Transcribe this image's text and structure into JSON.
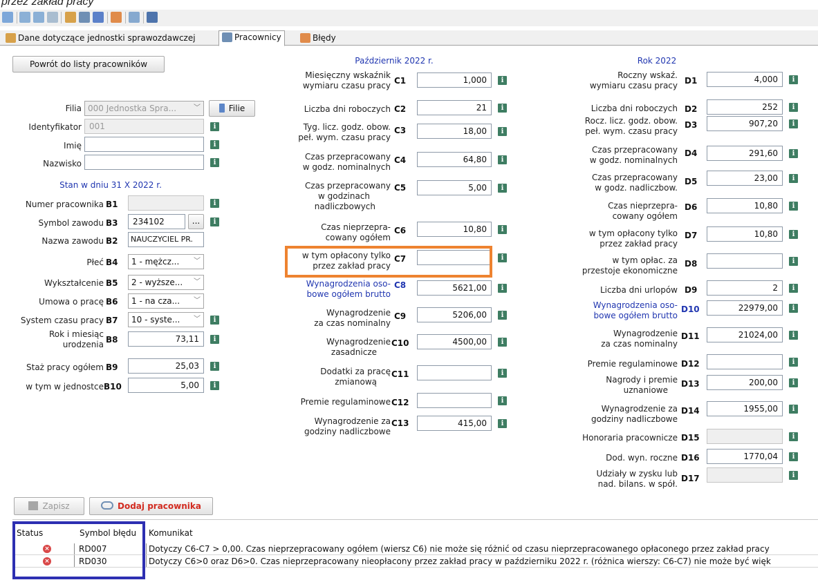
{
  "caption": "przez zakład pracy",
  "toolbar": {
    "icons": [
      "print-icon",
      "import-icon",
      "export-icon",
      "upload-icon",
      "home-icon",
      "glasses-icon",
      "copy-icon",
      "people-icon",
      "window-icon",
      "hierarchy-icon"
    ]
  },
  "tabs": [
    {
      "label": "Dane dotyczące jednostki sprawozdawczej",
      "icon": "home-icon",
      "active": false
    },
    {
      "label": "Pracownicy",
      "icon": "glasses-icon",
      "active": true
    },
    {
      "label": "Błędy",
      "icon": "error-icon",
      "active": false
    }
  ],
  "left": {
    "back_button": "Powrót do listy pracowników",
    "filia_label": "Filia",
    "filia_value": "000 Jednostka Spra...",
    "filie_button": "Filie",
    "identyfikator_label": "Identyfikator",
    "identyfikator_value": "001",
    "imie_label": "Imię",
    "imie_value": "",
    "nazwisko_label": "Nazwisko",
    "nazwisko_value": "",
    "stan_heading": "Stan w dniu 31 X 2022 r.",
    "rows": {
      "b1": {
        "label": "Numer pracownika",
        "code": "B1",
        "value": ""
      },
      "b3": {
        "label": "Symbol zawodu",
        "code": "B3",
        "value": "234102",
        "button": "..."
      },
      "b2": {
        "label": "Nazwa zawodu",
        "code": "B2",
        "value": "NAUCZYCIEL PR."
      },
      "b4": {
        "label": "Płeć",
        "code": "B4",
        "value": "1 - mężcz..."
      },
      "b5": {
        "label": "Wykształcenie",
        "code": "B5",
        "value": "2 - wyższe..."
      },
      "b6": {
        "label": "Umowa o pracę",
        "code": "B6",
        "value": "1 - na cza..."
      },
      "b7": {
        "label": "System czasu pracy",
        "code": "B7",
        "value": "10 - syste..."
      },
      "b8": {
        "label": "Rok i miesiąc urodzenia",
        "label1": "Rok i miesiąc",
        "label2": "urodzenia",
        "code": "B8",
        "value": "73,11"
      },
      "b9": {
        "label": "Staż pracy ogółem",
        "code": "B9",
        "value": "25,03"
      },
      "b10": {
        "label": "w tym w jednostce",
        "code": "B10",
        "value": "5,00"
      }
    }
  },
  "middle": {
    "heading": "Październik 2022 r.",
    "rows": {
      "c1": {
        "l1": "Miesięczny wskaźnik",
        "l2": "wymiaru czasu pracy",
        "code": "C1",
        "value": "1,000"
      },
      "c2": {
        "l1": "Liczba dni roboczych",
        "code": "C2",
        "value": "21"
      },
      "c3": {
        "l1": "Tyg. licz. godz. obow.",
        "l2": "peł. wym. czasu pracy",
        "code": "C3",
        "value": "18,00"
      },
      "c4": {
        "l1": "Czas przepracowany",
        "l2": "w godz. nominalnych",
        "code": "C4",
        "value": "64,80"
      },
      "c5": {
        "l1": "Czas przepracowany",
        "l2": "w godzinach",
        "l3": "nadliczbowych",
        "code": "C5",
        "value": "5,00"
      },
      "c6": {
        "l1": "Czas nieprzepra-",
        "l2": "cowany ogółem",
        "code": "C6",
        "value": "10,80"
      },
      "c7": {
        "l1": "w tym opłacony tylko",
        "l2": "przez zakład pracy",
        "code": "C7",
        "value": ""
      },
      "c8": {
        "l1": "Wynagrodzenia oso-",
        "l2": "bowe ogółem brutto",
        "code": "C8",
        "value": "5621,00"
      },
      "c9": {
        "l1": "Wynagrodzenie",
        "l2": "za czas nominalny",
        "code": "C9",
        "value": "5206,00"
      },
      "c10": {
        "l1": "Wynagrodzenie",
        "l2": "zasadnicze",
        "code": "C10",
        "value": "4500,00"
      },
      "c11": {
        "l1": "Dodatki za pracę",
        "l2": "zmianową",
        "code": "C11",
        "value": ""
      },
      "c12": {
        "l1": "Premie regulaminowe",
        "code": "C12",
        "value": ""
      },
      "c13": {
        "l1": "Wynagrodzenie za",
        "l2": "godziny nadliczbowe",
        "code": "C13",
        "value": "415,00"
      }
    }
  },
  "right": {
    "heading": "Rok 2022",
    "rows": {
      "d1": {
        "l1": "Roczny wskaź.",
        "l2": "wymiaru czasu pracy",
        "code": "D1",
        "value": "4,000"
      },
      "d2": {
        "l1": "Liczba dni roboczych",
        "code": "D2",
        "value": "252"
      },
      "d3": {
        "l1": "Rocz. licz. godz. obow.",
        "l2": "peł. wym. czasu pracy",
        "code": "D3",
        "value": "907,20"
      },
      "d4": {
        "l1": "Czas przepracowany",
        "l2": "w godz. nominalnych",
        "code": "D4",
        "value": "291,60"
      },
      "d5": {
        "l1": "Czas przepracowany",
        "l2": "w godz. nadliczbow.",
        "code": "D5",
        "value": "23,00"
      },
      "d6": {
        "l1": "Czas nieprzepra-",
        "l2": "cowany ogółem",
        "code": "D6",
        "value": "10,80"
      },
      "d7": {
        "l1": "w tym opłacony tylko",
        "l2": "przez zakład pracy",
        "code": "D7",
        "value": "10,80"
      },
      "d8": {
        "l1": "w tym opłac. za",
        "l2": "przestoje ekonomiczne",
        "code": "D8",
        "value": ""
      },
      "d9": {
        "l1": "Liczba dni urlopów",
        "code": "D9",
        "value": "2"
      },
      "d10": {
        "l1": "Wynagrodzenia oso-",
        "l2": "bowe ogółem brutto",
        "code": "D10",
        "value": "22979,00"
      },
      "d11": {
        "l1": "Wynagrodzenie",
        "l2": "za czas nominalny",
        "code": "D11",
        "value": "21024,00"
      },
      "d12": {
        "l1": "Premie regulaminowe",
        "code": "D12",
        "value": ""
      },
      "d13": {
        "l1": "Nagrody i premie",
        "l2": "uznaniowe",
        "code": "D13",
        "value": "200,00"
      },
      "d14": {
        "l1": "Wynagrodzenie za",
        "l2": "godziny nadliczbowe",
        "code": "D14",
        "value": "1955,00"
      },
      "d15": {
        "l1": "Honoraria pracownicze",
        "code": "D15",
        "value": ""
      },
      "d16": {
        "l1": "Dod. wyn. roczne",
        "code": "D16",
        "value": "1770,04"
      },
      "d17": {
        "l1": "Udziały w zysku lub",
        "l2": "nad. bilans. w spół.",
        "code": "D17",
        "value": ""
      }
    }
  },
  "actions": {
    "save": "Zapisz",
    "add": "Dodaj pracownika"
  },
  "errors": {
    "headers": {
      "status": "Status",
      "symbol": "Symbol błędu",
      "message": "Komunikat"
    },
    "rows": [
      {
        "symbol": "RD007",
        "message": "Dotyczy C6-C7 > 0,00. Czas nieprzepracowany ogółem (wiersz C6) nie może się różnić od czasu nieprzepracowanego opłaconego przez zakład pracy"
      },
      {
        "symbol": "RD030",
        "message": "Dotyczy C6>0 oraz D6>0. Czas nieprzepracowany nieopłacony przez zakład pracy w październiku 2022 r. (różnica wierszy: C6-C7) nie może być więk"
      }
    ]
  },
  "colors": {
    "accent_blue": "#2036b0",
    "info_green": "#3e7d62",
    "highlight_orange": "#ee8330",
    "highlight_blue": "#2d2fb2",
    "error_red": "#d94848"
  }
}
